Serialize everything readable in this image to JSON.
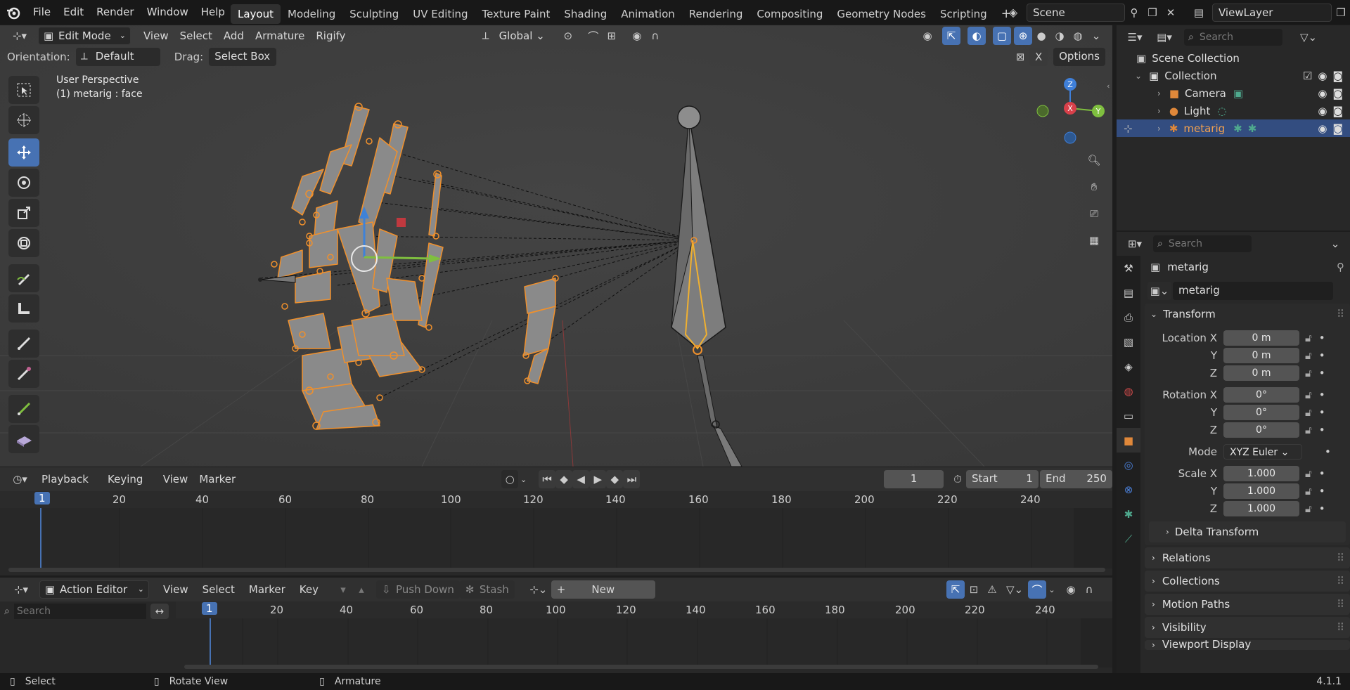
{
  "topbar": {
    "menus": [
      "File",
      "Edit",
      "Render",
      "Window",
      "Help"
    ],
    "workspaces": [
      "Layout",
      "Modeling",
      "Sculpting",
      "UV Editing",
      "Texture Paint",
      "Shading",
      "Animation",
      "Rendering",
      "Compositing",
      "Geometry Nodes",
      "Scripting"
    ],
    "active_workspace": "Layout",
    "scene": "Scene",
    "view_layer": "ViewLayer"
  },
  "viewport": {
    "mode": "Edit Mode",
    "menus": [
      "View",
      "Select",
      "Add",
      "Armature",
      "Rigify"
    ],
    "transform_orientation": "Global",
    "orientation_label": "Orientation:",
    "orientation_value": "Default",
    "drag_label": "Drag:",
    "drag_value": "Select Box",
    "x_label": "X",
    "options_label": "Options",
    "overlay_title": "User Perspective",
    "overlay_subtitle": "(1) metarig : face",
    "gizmo": {
      "z": "Z",
      "x": "X",
      "y": "Y"
    }
  },
  "timeline": {
    "menus": [
      "Playback",
      "Keying",
      "View",
      "Marker"
    ],
    "current_frame": "1",
    "start_label": "Start",
    "start_value": "1",
    "end_label": "End",
    "end_value": "250",
    "ticks": [
      "1",
      "20",
      "40",
      "60",
      "80",
      "100",
      "120",
      "140",
      "160",
      "180",
      "200",
      "220",
      "240"
    ]
  },
  "action_editor": {
    "mode": "Action Editor",
    "menus": [
      "View",
      "Select",
      "Marker",
      "Key"
    ],
    "push_down": "Push Down",
    "stash": "Stash",
    "new_label": "New",
    "search_placeholder": "Search",
    "ticks": [
      "1",
      "20",
      "40",
      "60",
      "80",
      "100",
      "120",
      "140",
      "160",
      "180",
      "200",
      "220",
      "240"
    ]
  },
  "outliner": {
    "search_placeholder": "Search",
    "root": "Scene Collection",
    "collection": "Collection",
    "items": [
      {
        "label": "Camera"
      },
      {
        "label": "Light"
      },
      {
        "label": "metarig"
      }
    ]
  },
  "properties": {
    "search_placeholder": "Search",
    "object_name": "metarig",
    "datablock_name": "metarig",
    "transform_label": "Transform",
    "location_label": "Location X",
    "y_label": "Y",
    "z_label": "Z",
    "location": [
      "0 m",
      "0 m",
      "0 m"
    ],
    "rotation_label": "Rotation X",
    "rotation": [
      "0°",
      "0°",
      "0°"
    ],
    "mode_label": "Mode",
    "mode_value": "XYZ Euler",
    "scale_label": "Scale X",
    "scale": [
      "1.000",
      "1.000",
      "1.000"
    ],
    "delta_label": "Delta Transform",
    "sections": [
      "Relations",
      "Collections",
      "Motion Paths",
      "Visibility",
      "Viewport Display"
    ]
  },
  "statusbar": {
    "select": "Select",
    "rotate": "Rotate View",
    "armature": "Armature",
    "version": "4.1.1"
  },
  "colors": {
    "accent": "#4772b3",
    "bone_orange": "#f0902c",
    "viewport_bg": "#3d3d3d"
  }
}
